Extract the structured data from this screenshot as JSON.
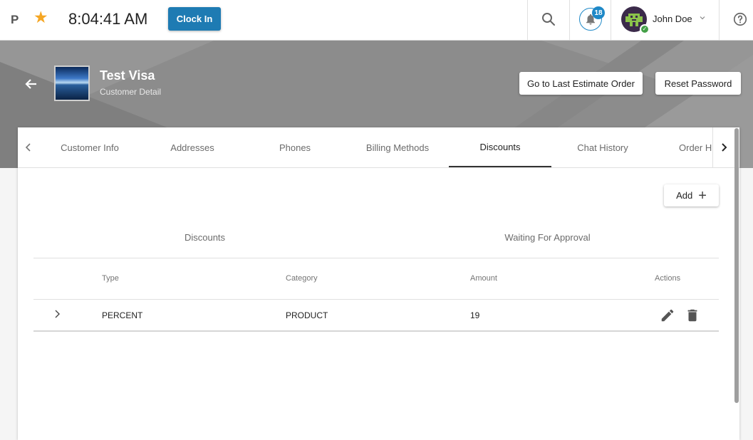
{
  "topbar": {
    "logo_letter": "P",
    "star_icon": "star-icon",
    "clock_time": "8:04:41 AM",
    "clock_in_label": "Clock In",
    "notification_count": "18",
    "user_name": "John Doe"
  },
  "header": {
    "customer_name": "Test Visa",
    "customer_subtitle": "Customer Detail",
    "last_estimate_label": "Go to Last Estimate Order",
    "reset_password_label": "Reset Password"
  },
  "tabs": [
    {
      "label": "Customer Info"
    },
    {
      "label": "Addresses"
    },
    {
      "label": "Phones"
    },
    {
      "label": "Billing Methods"
    },
    {
      "label": "Discounts",
      "active": true
    },
    {
      "label": "Chat History"
    },
    {
      "label": "Order His"
    }
  ],
  "add_label": "Add",
  "sub_tabs": [
    {
      "label": "Discounts"
    },
    {
      "label": "Waiting For Approval"
    }
  ],
  "table": {
    "headers": {
      "type": "Type",
      "category": "Category",
      "amount": "Amount",
      "actions": "Actions"
    },
    "rows": [
      {
        "type": "PERCENT",
        "category": "PRODUCT",
        "amount": "19"
      }
    ]
  },
  "colors": {
    "primary": "#1e7bb3",
    "accent_star": "#f5a623",
    "online": "#43a047"
  }
}
